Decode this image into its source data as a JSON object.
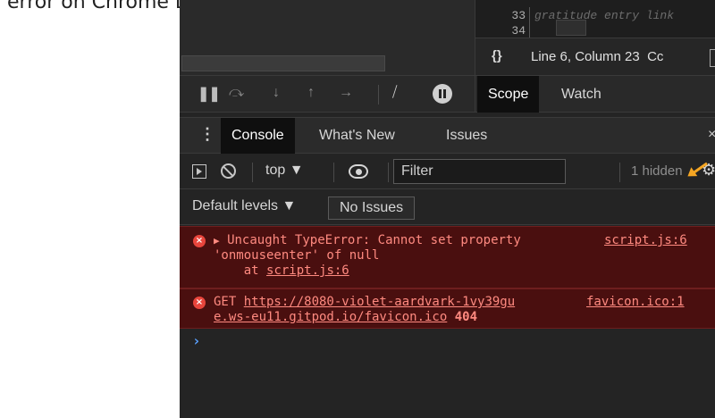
{
  "caption": "error on Chrome DevTools after the \"correction\":",
  "editor": {
    "line_numbers": [
      "33",
      "34"
    ],
    "code_snippet": "gratitude entry link",
    "braces_icon": "{}",
    "cursor_position": "Line 6, Column 23",
    "coverage_label": "Cc"
  },
  "debugger": {
    "pause_icon": "pause-icon",
    "side_tabs": [
      "Scope",
      "Watch"
    ]
  },
  "drawer": {
    "menu_icon": "⋮",
    "tabs": [
      "Console",
      "What's New",
      "Issues"
    ],
    "close_icon": "×"
  },
  "console_toolbar": {
    "context": "top ▼",
    "filter_placeholder": "Filter",
    "hidden_count": "1 hidden",
    "settings_icon": "gear-icon"
  },
  "levels": {
    "dropdown": "Default levels ▼",
    "issues_button": "No Issues"
  },
  "messages": [
    {
      "icon": "×",
      "expand": "▶",
      "line1": "Uncaught TypeError: Cannot set property",
      "line2": "'onmouseenter' of null",
      "at_prefix": "at ",
      "at_link": "script.js:6",
      "source": "script.js:6"
    },
    {
      "icon": "×",
      "method": "GET ",
      "url_line1": "https://8080-violet-aardvark-1vy39gu",
      "url_line2": "e.ws-eu11.gitpod.io/favicon.ico",
      "status": "404",
      "source": "favicon.ico:1"
    }
  ],
  "prompt": "›",
  "colors": {
    "error_bg": "#4a0f0f",
    "error_text": "#ff8a80",
    "prompt": "#5aa1ff",
    "annotation_arrow": "#f5a623"
  }
}
